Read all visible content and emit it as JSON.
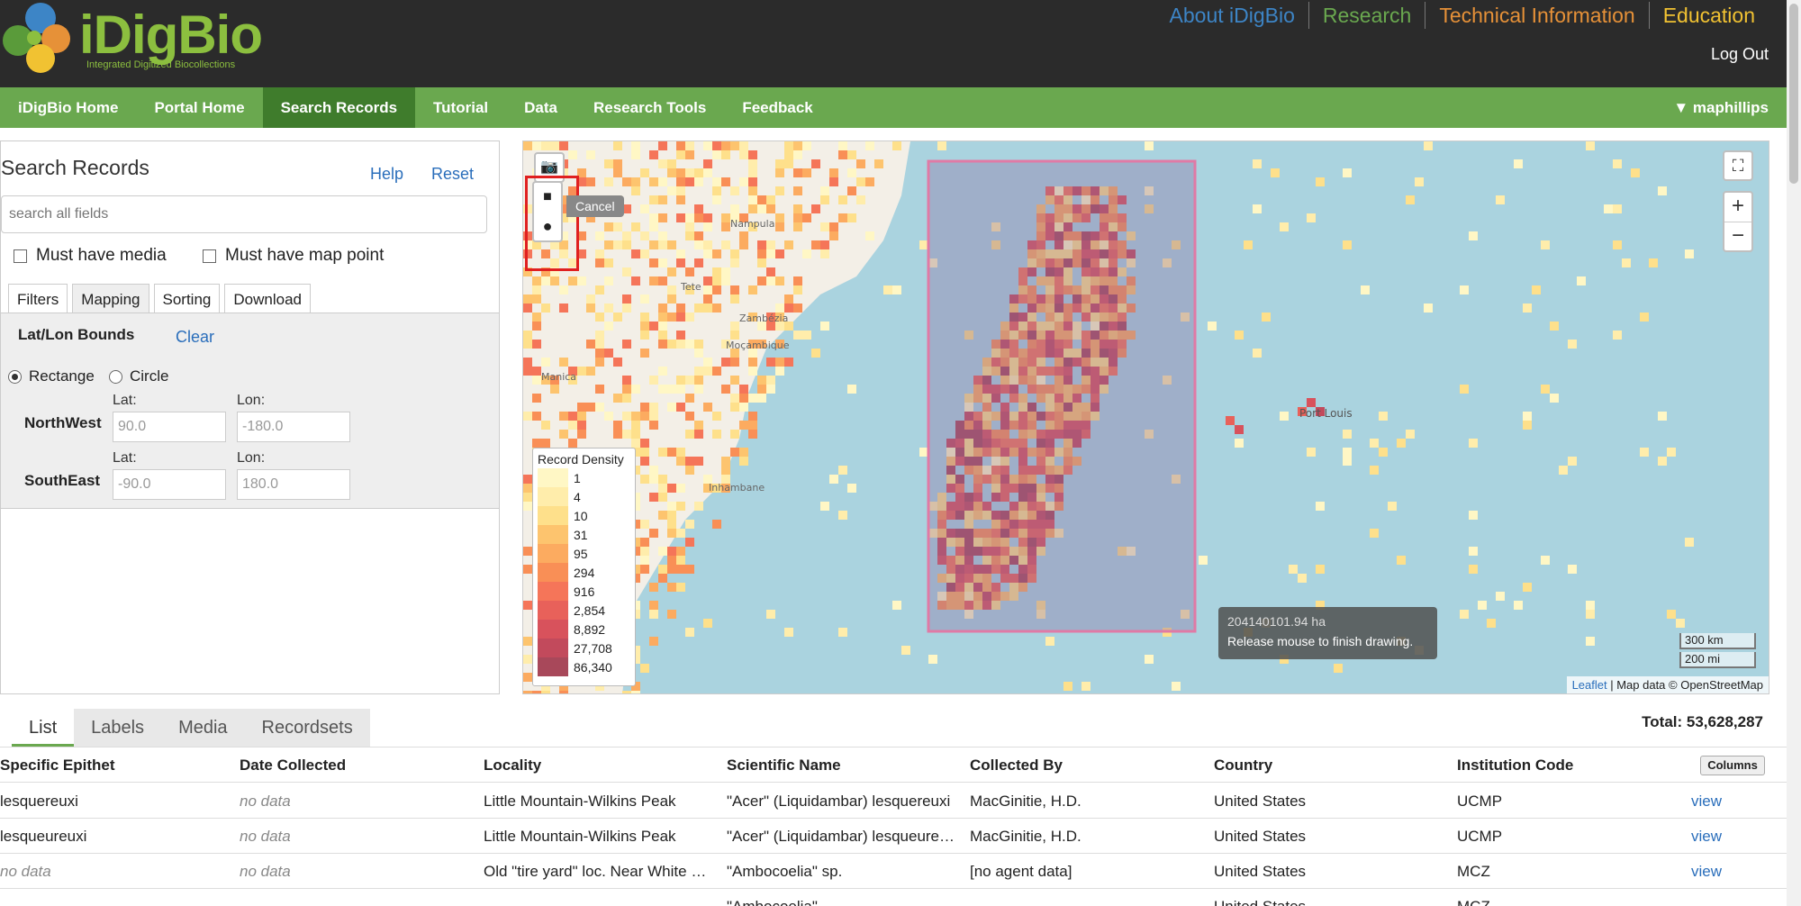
{
  "brand": {
    "name": "iDigBio",
    "tagline": "Integrated Digitized Biocollections"
  },
  "top_links": [
    {
      "label": "About iDigBio",
      "color": "#3d85c6"
    },
    {
      "label": "Research",
      "color": "#6aa84f"
    },
    {
      "label": "Technical Information",
      "color": "#e69138"
    },
    {
      "label": "Education",
      "color": "#f1c232"
    }
  ],
  "logout": "Log Out",
  "nav": {
    "items": [
      "iDigBio Home",
      "Portal Home",
      "Search Records",
      "Tutorial",
      "Data",
      "Research Tools",
      "Feedback"
    ],
    "active": "Search Records",
    "user": "▼  maphillips"
  },
  "search_panel": {
    "title": "Search Records",
    "help": "Help",
    "reset": "Reset",
    "search_placeholder": "search all fields",
    "must_have_media": "Must have media",
    "must_have_map_point": "Must have map point",
    "tabs": [
      "Filters",
      "Mapping",
      "Sorting",
      "Download"
    ],
    "active_tab": "Mapping",
    "mapping": {
      "heading": "Lat/Lon Bounds",
      "clear": "Clear",
      "rectangle": "Rectange",
      "circle": "Circle",
      "northwest": "NorthWest",
      "southeast": "SouthEast",
      "lat_label": "Lat:",
      "lon_label": "Lon:",
      "nw_lat": "90.0",
      "nw_lon": "-180.0",
      "se_lat": "-90.0",
      "se_lon": "180.0"
    }
  },
  "map": {
    "cancel": "Cancel",
    "legend_title": "Record Density",
    "legend": [
      {
        "label": "1",
        "color": "#fff7c5"
      },
      {
        "label": "4",
        "color": "#ffedab"
      },
      {
        "label": "10",
        "color": "#fee08b"
      },
      {
        "label": "31",
        "color": "#fdc46e"
      },
      {
        "label": "95",
        "color": "#fcab60"
      },
      {
        "label": "294",
        "color": "#f98f56"
      },
      {
        "label": "916",
        "color": "#f57559"
      },
      {
        "label": "2,854",
        "color": "#e8615a"
      },
      {
        "label": "8,892",
        "color": "#d8525c"
      },
      {
        "label": "27,708",
        "color": "#c24a5c"
      },
      {
        "label": "86,340",
        "color": "#a8485a"
      }
    ],
    "tooltip_area": "204140101.94 ha",
    "tooltip_text": "Release mouse to finish drawing.",
    "scale_km": "300 km",
    "scale_mi": "200 mi",
    "attribution_link": "Leaflet",
    "attribution_text": " | Map data © OpenStreetMap",
    "place_labels": [
      "Port Louis",
      "Nampula",
      "Zambézia",
      "Tete",
      "Inhambane",
      "Moçambique",
      "Manica"
    ]
  },
  "results": {
    "tabs": [
      "List",
      "Labels",
      "Media",
      "Recordsets"
    ],
    "active_tab": "List",
    "total": "Total: 53,628,287",
    "columns_button": "Columns",
    "headers": [
      "Specific Epithet",
      "Date Collected",
      "Locality",
      "Scientific Name",
      "Collected By",
      "Country",
      "Institution Code",
      ""
    ],
    "rows": [
      [
        "lesquereuxi",
        "no data",
        "Little Mountain-Wilkins Peak",
        "\"Acer\" (Liquidambar) lesquereuxi",
        "MacGinitie, H.D.",
        "United States",
        "UCMP",
        "view"
      ],
      [
        "lesqueureuxi",
        "no data",
        "Little Mountain-Wilkins Peak",
        "\"Acer\" (Liquidambar) lesqueureuxi",
        "MacGinitie, H.D.",
        "United States",
        "UCMP",
        "view"
      ],
      [
        "no data",
        "no data",
        "Old \"tire yard\" loc. Near White River",
        "\"Ambocoelia\" sp.",
        "[no agent data]",
        "United States",
        "MCZ",
        "view"
      ],
      [
        "",
        "",
        "",
        "\"Ambocoelia\"",
        "",
        "United States",
        "MCZ",
        ""
      ]
    ]
  }
}
